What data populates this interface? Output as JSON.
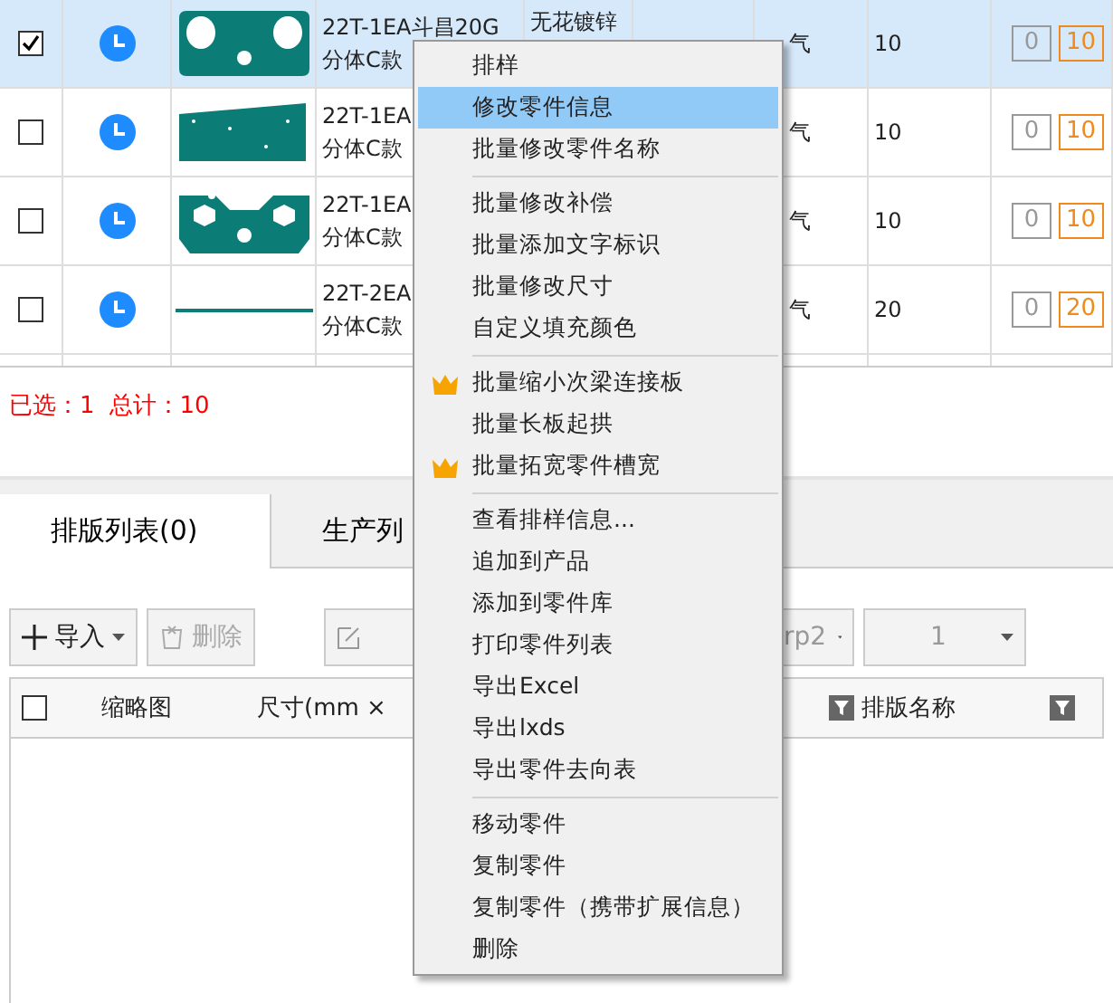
{
  "parts_table": {
    "rows": [
      {
        "checked": true,
        "selected": true,
        "name": "22T-1EA斗昌20G",
        "name_line2": "分体C款",
        "material": "无花镀锌",
        "gas": "气",
        "quantity": "10",
        "done": "0",
        "total": "10",
        "kind": "plate"
      },
      {
        "checked": false,
        "selected": false,
        "name": "22T-1EA",
        "name_line2": "分体C款",
        "gas": "气",
        "quantity": "10",
        "done": "0",
        "total": "10",
        "kind": "panel"
      },
      {
        "checked": false,
        "selected": false,
        "name": "22T-1EA",
        "name_line2": "分体C款",
        "gas": "气",
        "quantity": "10",
        "done": "0",
        "total": "10",
        "kind": "hexplate"
      },
      {
        "checked": false,
        "selected": false,
        "name": "22T-2EA",
        "name_line2": "分体C款",
        "gas": "气",
        "quantity": "20",
        "done": "0",
        "total": "20",
        "kind": "strip"
      }
    ]
  },
  "summary": {
    "selected": "已选：1",
    "total": "总计：10"
  },
  "tabs": [
    {
      "label": "排版列表(0)",
      "selected": true
    },
    {
      "label": "生产列",
      "selected": false
    }
  ],
  "toolbar": {
    "import": "导入",
    "delete": "删除",
    "delete_disabled": true,
    "machine": "rp2",
    "count": "1"
  },
  "layout_table": {
    "header_checked": false,
    "columns": [
      "缩略图",
      "尺寸(mm ×",
      "排版名称"
    ]
  },
  "context_menu": [
    {
      "kind": "item",
      "label": "排样",
      "vip": false,
      "selected": false
    },
    {
      "kind": "item",
      "label": "修改零件信息",
      "vip": false,
      "selected": true
    },
    {
      "kind": "item",
      "label": "批量修改零件名称",
      "vip": false,
      "selected": false
    },
    {
      "kind": "separator"
    },
    {
      "kind": "item",
      "label": "批量修改补偿",
      "vip": false,
      "selected": false
    },
    {
      "kind": "item",
      "label": "批量添加文字标识",
      "vip": false,
      "selected": false
    },
    {
      "kind": "item",
      "label": "批量修改尺寸",
      "vip": false,
      "selected": false
    },
    {
      "kind": "item",
      "label": "自定义填充颜色",
      "vip": false,
      "selected": false
    },
    {
      "kind": "separator"
    },
    {
      "kind": "item",
      "label": "批量缩小次梁连接板",
      "vip": true,
      "selected": false
    },
    {
      "kind": "item",
      "label": "批量长板起拱",
      "vip": false,
      "selected": false
    },
    {
      "kind": "item",
      "label": "批量拓宽零件槽宽",
      "vip": true,
      "selected": false
    },
    {
      "kind": "separator"
    },
    {
      "kind": "item",
      "label": "查看排样信息...",
      "vip": false,
      "selected": false
    },
    {
      "kind": "item",
      "label": "追加到产品",
      "vip": false,
      "selected": false
    },
    {
      "kind": "item",
      "label": "添加到零件库",
      "vip": false,
      "selected": false
    },
    {
      "kind": "item",
      "label": "打印零件列表",
      "vip": false,
      "selected": false
    },
    {
      "kind": "item",
      "label": "导出Excel",
      "vip": false,
      "selected": false
    },
    {
      "kind": "item",
      "label": "导出lxds",
      "vip": false,
      "selected": false
    },
    {
      "kind": "item",
      "label": "导出零件去向表",
      "vip": false,
      "selected": false
    },
    {
      "kind": "separator"
    },
    {
      "kind": "item",
      "label": "移动零件",
      "vip": false,
      "selected": false
    },
    {
      "kind": "item",
      "label": "复制零件",
      "vip": false,
      "selected": false
    },
    {
      "kind": "item",
      "label": "复制零件（携带扩展信息）",
      "vip": false,
      "selected": false
    },
    {
      "kind": "item",
      "label": "删除",
      "vip": false,
      "selected": false
    }
  ]
}
